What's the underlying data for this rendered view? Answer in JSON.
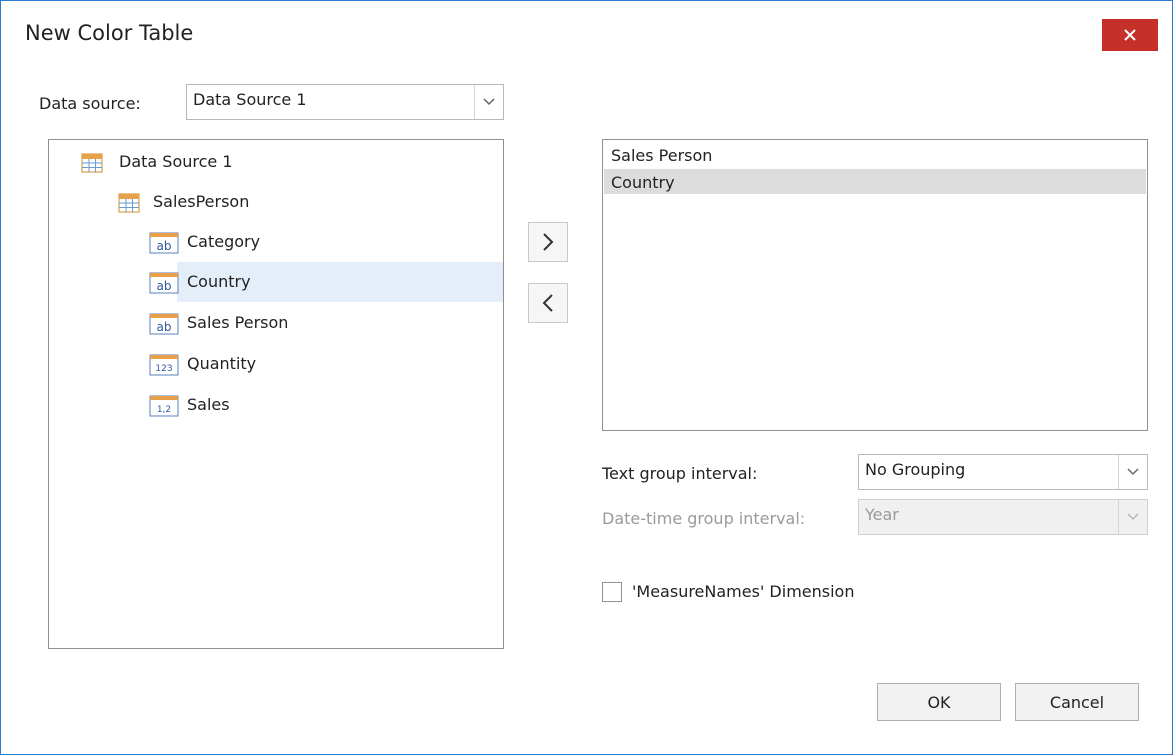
{
  "window": {
    "title": "New Color Table"
  },
  "datasource": {
    "label": "Data source:",
    "value": "Data Source 1"
  },
  "tree": {
    "root": "Data Source 1",
    "table": "SalesPerson",
    "fields": [
      {
        "label": "Category",
        "icon": "text-field-icon",
        "glyph": "ab"
      },
      {
        "label": "Country",
        "icon": "text-field-icon",
        "glyph": "ab",
        "selected": true
      },
      {
        "label": "Sales Person",
        "icon": "text-field-icon",
        "glyph": "ab"
      },
      {
        "label": "Quantity",
        "icon": "integer-field-icon",
        "glyph": "123"
      },
      {
        "label": "Sales",
        "icon": "decimal-field-icon",
        "glyph": "1,2"
      }
    ]
  },
  "selected_list": {
    "items": [
      {
        "label": "Sales Person"
      },
      {
        "label": "Country",
        "selected": true
      }
    ]
  },
  "text_group": {
    "label": "Text group interval:",
    "value": "No Grouping"
  },
  "date_group": {
    "label": "Date-time group interval:",
    "value": "Year"
  },
  "measure_names": {
    "label": "'MeasureNames' Dimension",
    "checked": false
  },
  "buttons": {
    "ok": "OK",
    "cancel": "Cancel"
  },
  "colors": {
    "accent": "#2b7bd1",
    "close": "#c6302a",
    "selection": "#e4eef9"
  }
}
